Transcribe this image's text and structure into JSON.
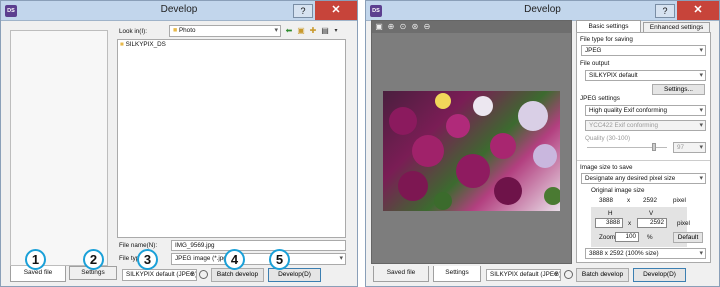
{
  "left": {
    "title": "Develop",
    "help": "?",
    "close": "✕",
    "look_in_label": "Look in(I):",
    "folder": "Photo",
    "folder_item": "SILKYPIX_DS",
    "file_name_label": "File name(N):",
    "file_name_value": "IMG_9569.jpg",
    "file_type_label": "File typ",
    "file_type_value": "JPEG image (*.jpg)",
    "tabs": {
      "saved": "Saved file",
      "settings": "Settings"
    },
    "preset": "SILKYPIX default (JPEG)",
    "batch": "Batch develop",
    "develop": "Develop(D)",
    "badges": [
      "1",
      "2",
      "3",
      "4",
      "5"
    ]
  },
  "right": {
    "title": "Develop",
    "help": "?",
    "close": "✕",
    "tabs": {
      "basic": "Basic settings",
      "enhanced": "Enhanced settings"
    },
    "file_type_for_saving_label": "File type for saving",
    "file_type_for_saving": "JPEG",
    "file_output_label": "File output",
    "file_output": "SILKYPIX default",
    "settings_btn": "Settings...",
    "jpeg_settings_label": "JPEG settings",
    "jpeg_quality_mode": "High quality Exif conforming",
    "ycc": "YCC422 Exif conforming",
    "quality_label": "Quality (30-100)",
    "quality_value": "97",
    "image_size_label": "Image size to save",
    "size_mode": "Designate any desired pixel size",
    "original_size_label": "Original image size",
    "orig_w": "3888",
    "orig_x": "x",
    "orig_h": "2592",
    "pixel": "pixel",
    "h_label": "H",
    "v_label": "V",
    "new_w": "3888",
    "new_x": "x",
    "new_h": "2592",
    "pixel2": "pixel",
    "zoom_label": "Zoom",
    "zoom_value": "100",
    "percent": "%",
    "default_btn": "Default",
    "size_preset": "3888 x 2592  (100% size)",
    "saved_tab": "Saved file",
    "settings_tab": "Settings",
    "preset": "SILKYPIX default (JPEG)",
    "batch": "Batch develop",
    "develop": "Develop(D)"
  },
  "colors": {
    "titlebar": "#c2d6ec",
    "close": "#c7443a",
    "badge": "#1aa0d8",
    "preview_bg": "#7d7d7d",
    "folder": "#e8b94a"
  }
}
